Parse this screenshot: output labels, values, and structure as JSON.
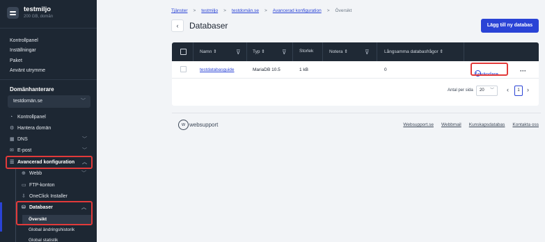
{
  "account": {
    "name": "testmiljo",
    "plan": "200 GB, domän"
  },
  "sidebar_top": [
    "Kontrollpanel",
    "Inställningar",
    "Paket",
    "Använt utrymme"
  ],
  "domain_section": {
    "heading": "Domänhanterare",
    "selected_domain": "testdomän.se"
  },
  "domain_menu": {
    "kontrollpanel": "Kontrollpanel",
    "hantera": "Hantera domän",
    "dns": "DNS",
    "epost": "E-post",
    "avancerad": "Avancerad konfiguration",
    "webb": "Webb",
    "ftp": "FTP-konton",
    "oneclick": "OneClick Installer",
    "databaser": "Databaser",
    "oversikt": "Översikt",
    "global_history": "Global ändringshistorik",
    "global_stats": "Global statistik"
  },
  "breadcrumb": [
    "Tjänster",
    "testmiljo",
    "testdomän.se",
    "Avancerad konfiguration",
    "Översikt"
  ],
  "page": {
    "title": "Databaser",
    "add_button": "Lägg till ny databas"
  },
  "table": {
    "headers": {
      "name": "Namn",
      "type": "Typ",
      "size": "Storlek",
      "note": "Notera",
      "slow": "Långsamma databasfrågor"
    },
    "row": {
      "name": "testdatabasguide",
      "type": "MariaDB 10.5",
      "size": "1 kB",
      "note": "",
      "slow": "0",
      "users": "Användare",
      "more": "···"
    }
  },
  "pagination": {
    "label": "Antal per sida",
    "per_page": "20",
    "current": "1"
  },
  "footer": {
    "logo": "websupport",
    "links": [
      "Websupport.se",
      "Webbmail",
      "Kunskapsdatabas",
      "Kontakta oss"
    ]
  },
  "colors": {
    "accent": "#2a43d6",
    "highlight": "#e23a3a",
    "sidebar": "#1d2733"
  }
}
